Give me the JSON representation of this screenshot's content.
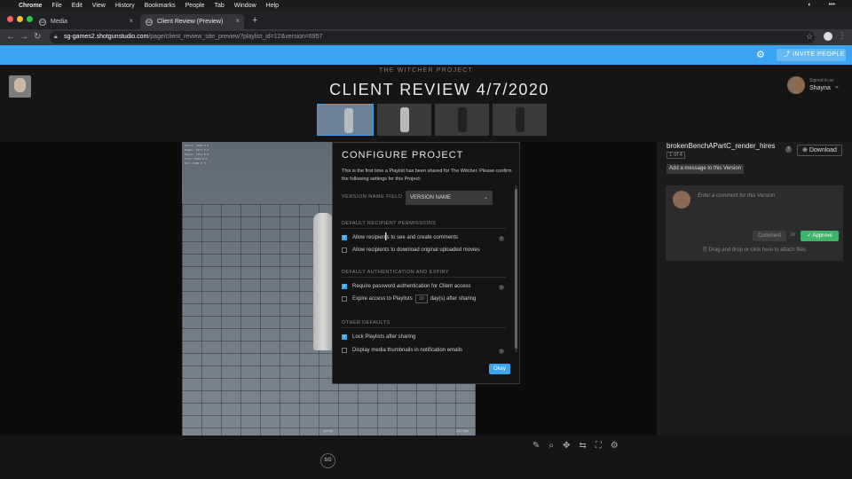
{
  "macos_menu": {
    "apple": "",
    "app": "Chrome",
    "items": [
      "File",
      "Edit",
      "View",
      "History",
      "Bookmarks",
      "People",
      "Tab",
      "Window",
      "Help"
    ]
  },
  "browser": {
    "tabs": [
      {
        "label": "Media",
        "favicon": "SG"
      },
      {
        "label": "Client Review (Preview)",
        "favicon": "SG"
      }
    ],
    "new_tab": "+",
    "url_host": "sg-games2.shotgunstudio.com",
    "url_path": "/page/client_review_site_preview?playlist_id=12&version=6957"
  },
  "topbar": {
    "invite_label": "INVITE PEOPLE",
    "accent": "#3ba4f0"
  },
  "header": {
    "project": "THE WITCHER PROJECT",
    "title": "CLIENT REVIEW 4/7/2020",
    "signed_in_label": "Signed in as",
    "user_name": "Shayna"
  },
  "viewer": {
    "fps": "24.0 fps",
    "camera": "persp",
    "stats": [
      [
        "Verts:",
        "1989",
        "0",
        "0"
      ],
      [
        "Edges:",
        "3977",
        "0",
        "0"
      ],
      [
        "Faces:",
        "1991",
        "0",
        "0"
      ],
      [
        "Tris:",
        "3946",
        "0",
        "0"
      ],
      [
        "UVs:",
        "2289",
        "0",
        "0"
      ]
    ]
  },
  "version_panel": {
    "name": "brokenBenchAPartC_render_hires",
    "count": "1 of 4",
    "download_label": "Download",
    "add_message_label": "Add a message to this Version",
    "comment_placeholder": "Enter a comment for this Version",
    "comment_button": "Comment",
    "or_label": "or",
    "approve_button": "Approve",
    "attach_text": "Drag and drop or click here to attach files",
    "approve_color": "#3fb36a"
  },
  "modal": {
    "title": "CONFIGURE PROJECT",
    "intro": "This is the first time a Playlist has been shared for The Witcher. Please confirm the following settings for this Project:",
    "version_name_field_label": "VERSION NAME FIELD",
    "version_name_value": "VERSION NAME",
    "section_permissions": "DEFAULT RECIPIENT PERMISSIONS",
    "perm_comments": "Allow recipients to see and create comments",
    "perm_download": "Allow recipients to download original uploaded movies",
    "section_auth": "DEFAULT AUTHENTICATION AND EXPIRY",
    "auth_password": "Require password authentication for Client access",
    "expire_prefix": "Expire access to Playlists",
    "expire_days": "10",
    "expire_suffix": "day(s) after sharing",
    "section_other": "OTHER DEFAULTS",
    "lock_playlists": "Lock Playlists after sharing",
    "display_thumbs": "Display media thumbnails in notification emails",
    "okay_label": "Okay",
    "checked": {
      "perm_comments": true,
      "perm_download": false,
      "auth_password": true,
      "expire": false,
      "lock_playlists": true,
      "display_thumbs": false
    }
  },
  "footer_logo": "SG"
}
